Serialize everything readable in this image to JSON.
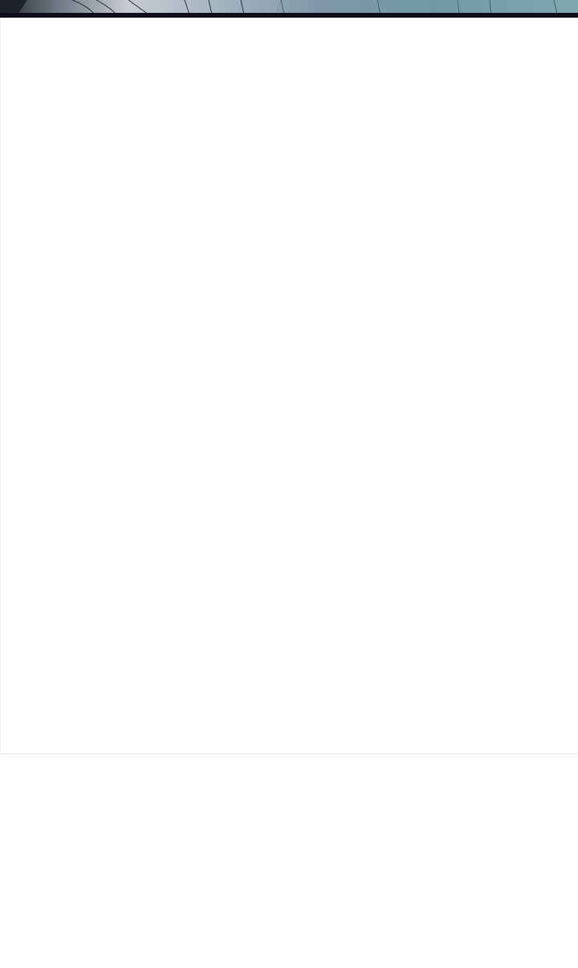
{
  "header_image": {
    "description_colors": {
      "dark_band": "#0b0f17",
      "accent_teal": "#6f98a6",
      "light_gray": "#c7ccd3"
    }
  },
  "content": {},
  "footer": {}
}
